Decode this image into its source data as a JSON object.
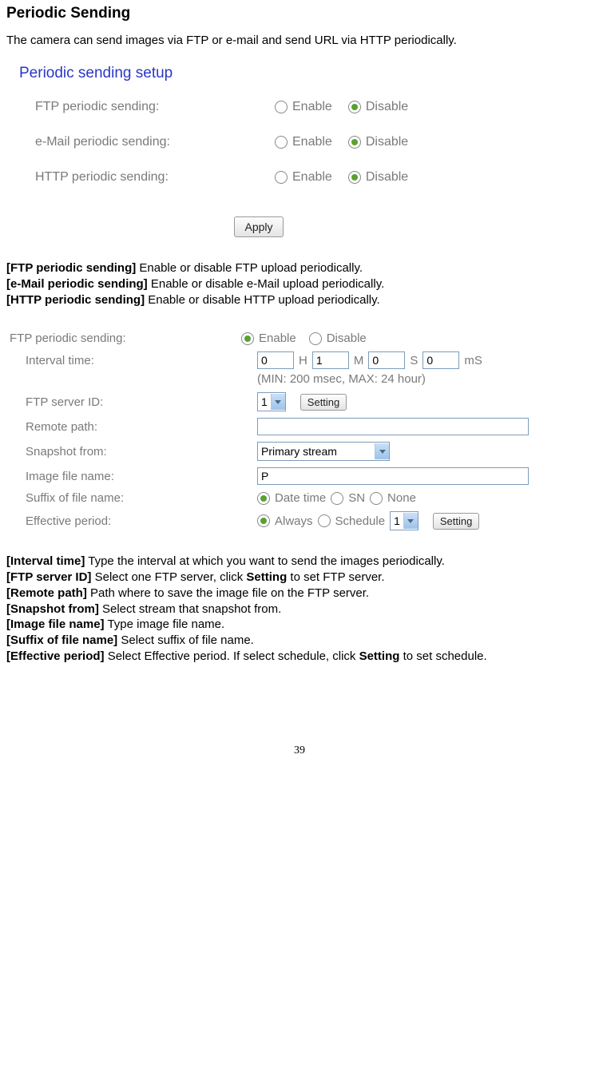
{
  "title": "Periodic Sending",
  "intro": "The camera can send images via FTP or e-mail and send URL via HTTP periodically.",
  "setup": {
    "panel_title": "Periodic sending setup",
    "rows": [
      {
        "label": "FTP periodic sending:",
        "enable": "Enable",
        "disable": "Disable"
      },
      {
        "label": "e-Mail periodic sending:",
        "enable": "Enable",
        "disable": "Disable"
      },
      {
        "label": "HTTP periodic sending:",
        "enable": "Enable",
        "disable": "Disable"
      }
    ],
    "apply": "Apply"
  },
  "defs1": {
    "ftp_label": "[FTP periodic sending]",
    "ftp_text": " Enable or disable FTP upload periodically.",
    "email_label": "[e-Mail periodic sending]",
    "email_text": " Enable or disable e-Mail upload periodically.",
    "http_label": "[HTTP periodic sending]",
    "http_text": " Enable or disable HTTP upload periodically."
  },
  "ftp": {
    "title": "FTP periodic sending:",
    "enable": "Enable",
    "disable": "Disable",
    "interval_label": "Interval time:",
    "h_val": "0",
    "h_unit": "H",
    "m_val": "1",
    "m_unit": "M",
    "s_val": "0",
    "s_unit": "S",
    "ms_val": "0",
    "ms_unit": "mS",
    "minmax": "(MIN: 200 msec, MAX: 24 hour)",
    "server_label": "FTP server ID:",
    "server_val": "1",
    "setting_btn": "Setting",
    "remote_label": "Remote path:",
    "remote_val": "",
    "snapshot_label": "Snapshot from:",
    "snapshot_val": "Primary stream",
    "filename_label": "Image file name:",
    "filename_val": "P",
    "suffix_label": "Suffix of file name:",
    "suffix_date": "Date time",
    "suffix_sn": "SN",
    "suffix_none": "None",
    "effective_label": "Effective period:",
    "effective_always": "Always",
    "effective_schedule": "Schedule",
    "schedule_val": "1",
    "schedule_setting": "Setting"
  },
  "defs2": {
    "interval_label": "[Interval time]",
    "interval_text": " Type the interval at which you want to send the images periodically.",
    "server_label": "[FTP server ID]",
    "server_text1": " Select one FTP server, click ",
    "server_bold": "Setting",
    "server_text2": " to set FTP server.",
    "remote_label": "[Remote path]",
    "remote_text": " Path where to save the image file on the FTP server.",
    "snapshot_label": "[Snapshot from]",
    "snapshot_text": " Select stream that snapshot from.",
    "filename_label": "[Image file name]",
    "filename_text": " Type image file name.",
    "suffix_label": "[Suffix of file name]",
    "suffix_text": " Select suffix of file name.",
    "effective_label": "[Effective period]",
    "effective_text1": " Select Effective period. If select   schedule, click ",
    "effective_bold": "Setting",
    "effective_text2": " to set schedule."
  },
  "page_number": "39"
}
